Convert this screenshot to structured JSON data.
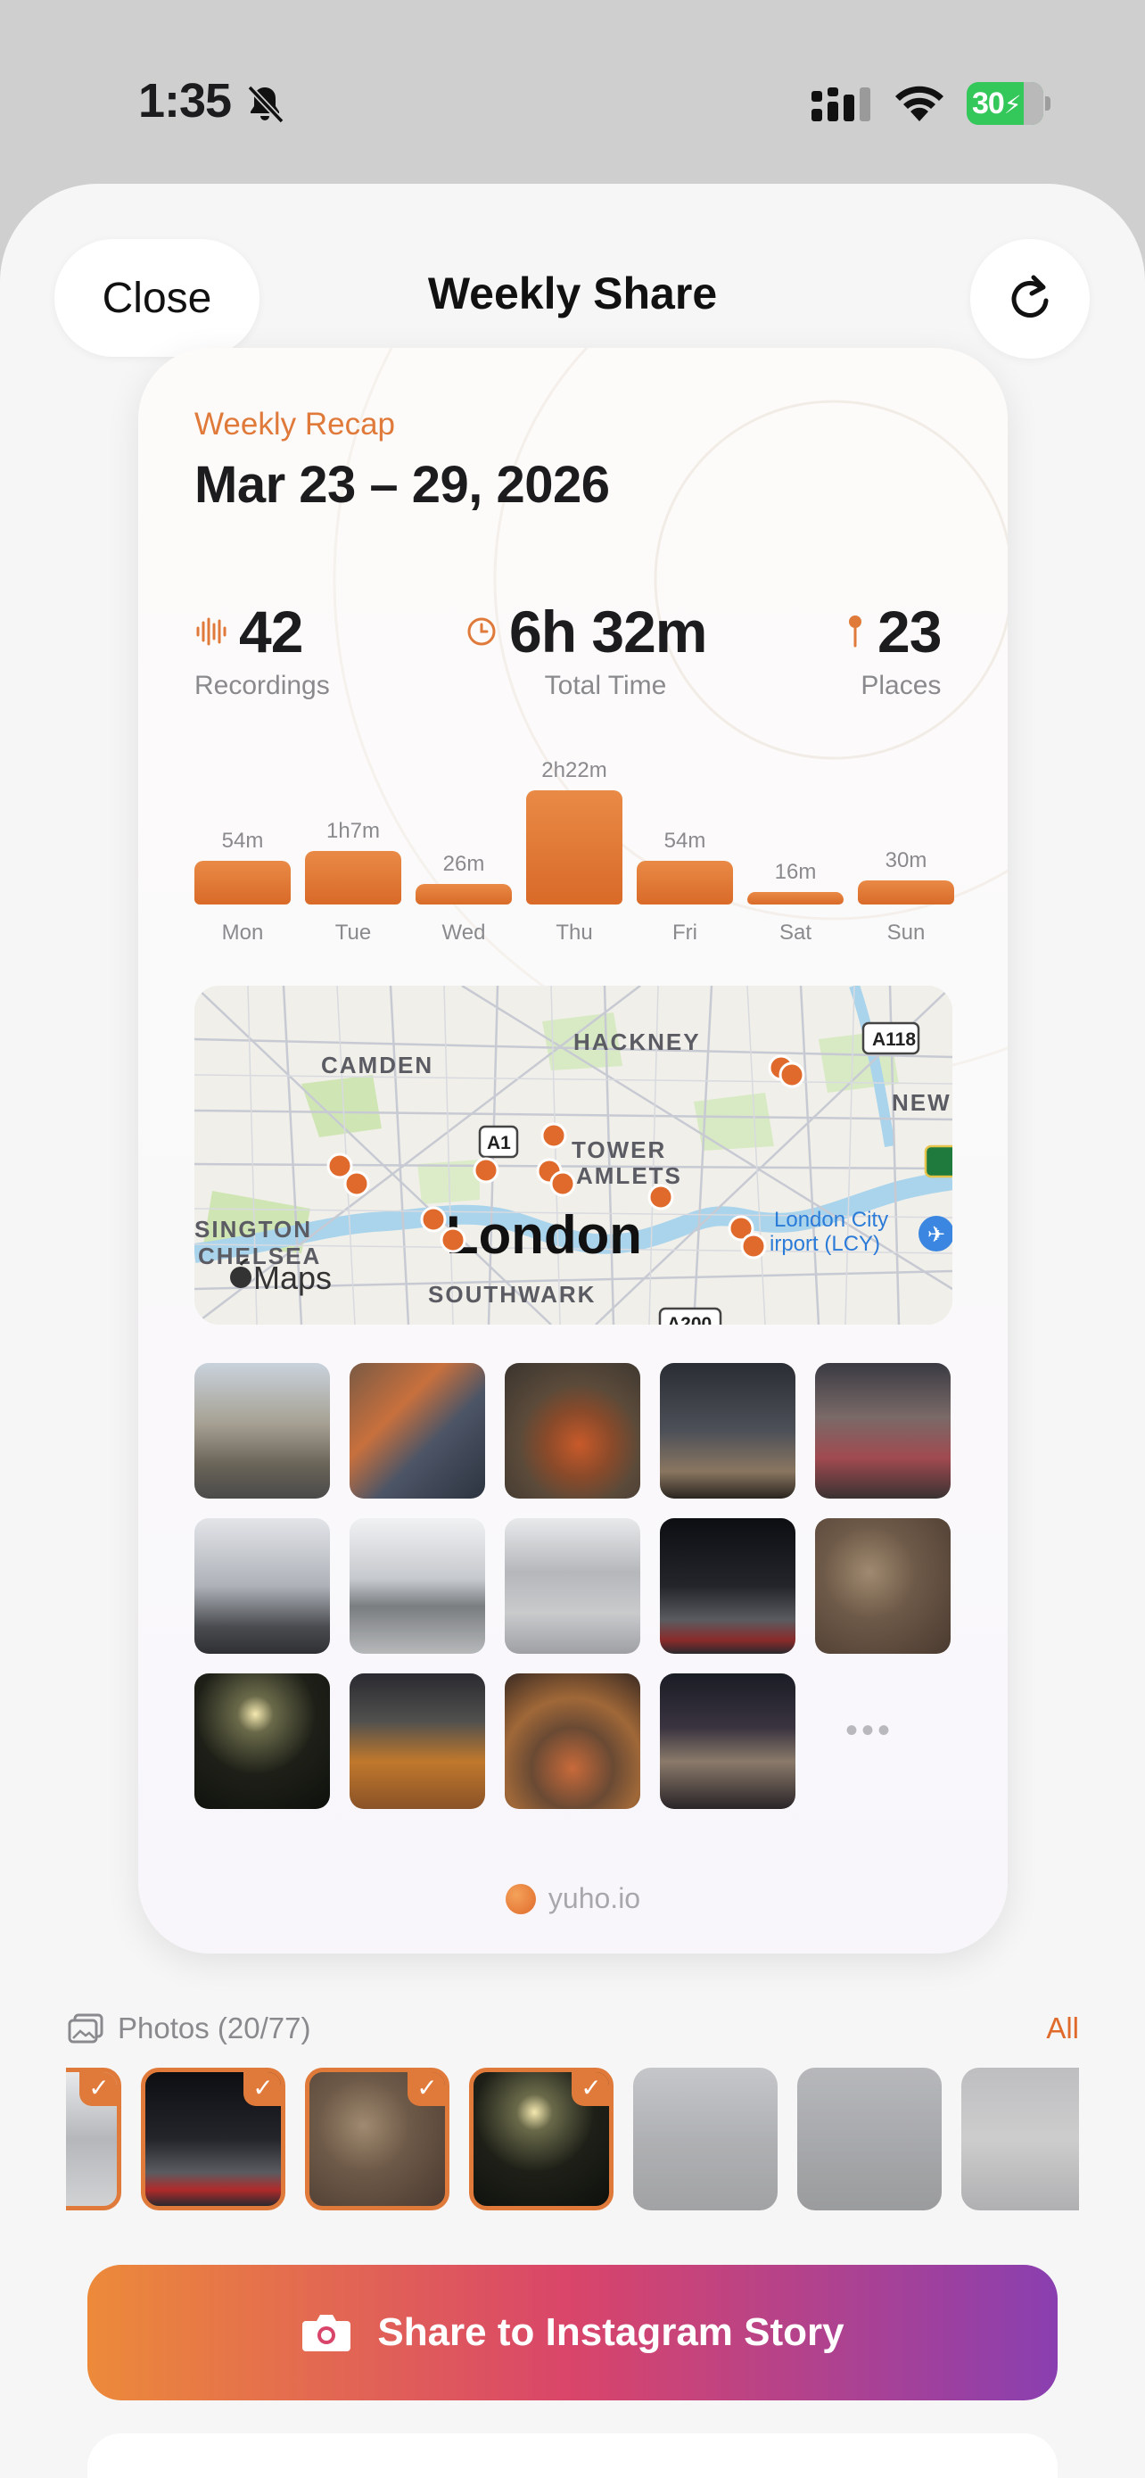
{
  "status_bar": {
    "time": "1:35",
    "battery": "30"
  },
  "sheet": {
    "close_label": "Close",
    "title": "Weekly Share"
  },
  "card": {
    "recap_label": "Weekly Recap",
    "date_range": "Mar 23 – 29, 2026",
    "stats": {
      "recordings": {
        "value": "42",
        "label": "Recordings"
      },
      "total_time": {
        "value": "6h 32m",
        "label": "Total Time"
      },
      "places": {
        "value": "23",
        "label": "Places"
      }
    },
    "footer_brand": "yuho.io"
  },
  "chart_data": {
    "type": "bar",
    "categories": [
      "Mon",
      "Tue",
      "Wed",
      "Thu",
      "Fri",
      "Sat",
      "Sun"
    ],
    "values": [
      54,
      67,
      26,
      142,
      54,
      16,
      30
    ],
    "value_labels": [
      "54m",
      "1h7m",
      "26m",
      "2h22m",
      "54m",
      "16m",
      "30m"
    ],
    "accent": "#e07a3a"
  },
  "map": {
    "attribution": "Maps",
    "labels": {
      "hackney": "HACKNEY",
      "camden": "CAMDEN",
      "a118": "A118",
      "newham": "NEWH",
      "a1": "A1",
      "tower": "TOWER",
      "hamlets": "AMLETS",
      "kensington": "SINGTON",
      "chelsea": "CHELSEA",
      "london": "London",
      "southwark": "SOUTHWARK",
      "airport": "London City\nirport (LCY)",
      "a200": "A200",
      "a13": "A1"
    }
  },
  "photo_grid": {
    "more": "•••"
  },
  "photo_picker": {
    "title": "Photos (20/77)",
    "all_label": "All",
    "check": "✓"
  },
  "share_button": {
    "label": "Share to Instagram Story"
  },
  "colors": {
    "accent": "#e07a3a",
    "instagram_start": "#ec8a3a",
    "instagram_end": "#8a3fb0"
  },
  "icons": [
    "bell-slash-icon",
    "cellular-icon",
    "wifi-icon",
    "battery-icon",
    "refresh-icon",
    "waveform-icon",
    "clock-icon",
    "pin-icon",
    "apple-logo-icon",
    "photos-icon",
    "camera-icon",
    "airport-icon"
  ]
}
